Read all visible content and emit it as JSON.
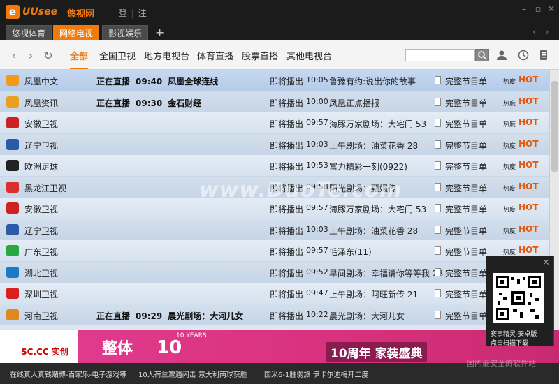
{
  "app": {
    "logo_letter": "e",
    "logo_name": "UUsee",
    "logo_cn": "悠视网",
    "login": "登",
    "register": "注",
    "separator": "|"
  },
  "tabs": [
    {
      "label": "悠视体育"
    },
    {
      "label": "网络电视"
    },
    {
      "label": "影视娱乐"
    }
  ],
  "nav": {
    "categories": [
      "全部",
      "全国卫视",
      "地方电视台",
      "体育直播",
      "股票直播",
      "其他电视台"
    ],
    "search_placeholder": ""
  },
  "columns": {
    "full_schedule": "完整节目单",
    "hot_label": "热度",
    "hot_badge": "HOT",
    "upcoming": "即将播出",
    "live": "正在直播"
  },
  "channels": [
    {
      "name": "凤凰中文",
      "icon_color": "#f29a1c",
      "live_time": "09:40",
      "live_prog": "凤凰全球连线",
      "up_time": "10:05",
      "up_prog": "鲁豫有约:说出你的故事"
    },
    {
      "name": "凤凰资讯",
      "icon_color": "#e8a020",
      "live_time": "09:30",
      "live_prog": "金石财经",
      "up_time": "10:00",
      "up_prog": "凤凰正点播报"
    },
    {
      "name": "安徽卫视",
      "icon_color": "#cc2222",
      "live_time": "",
      "live_prog": "",
      "up_time": "09:57",
      "up_prog": "海豚万家剧场：大宅门 53"
    },
    {
      "name": "辽宁卫视",
      "icon_color": "#2a5aa8",
      "live_time": "",
      "live_prog": "",
      "up_time": "10:03",
      "up_prog": "上午剧场：油菜花香 28"
    },
    {
      "name": "欧洲足球",
      "icon_color": "#222222",
      "live_time": "",
      "live_prog": "",
      "up_time": "10:53",
      "up_prog": "富力精彩一刻(0922)"
    },
    {
      "name": "黑龙江卫视",
      "icon_color": "#d83030",
      "live_time": "",
      "live_prog": "",
      "up_time": "09:58",
      "up_prog": "阳光剧场：甄嬛传"
    },
    {
      "name": "安徽卫视",
      "icon_color": "#cc2222",
      "live_time": "",
      "live_prog": "",
      "up_time": "09:57",
      "up_prog": "海豚万家剧场：大宅门 53"
    },
    {
      "name": "辽宁卫视",
      "icon_color": "#2a5aa8",
      "live_time": "",
      "live_prog": "",
      "up_time": "10:03",
      "up_prog": "上午剧场：油菜花香 28"
    },
    {
      "name": "广东卫视",
      "icon_color": "#2aa840",
      "live_time": "",
      "live_prog": "",
      "up_time": "09:57",
      "up_prog": "毛泽东(11)"
    },
    {
      "name": "湖北卫视",
      "icon_color": "#1a7ac8",
      "live_time": "",
      "live_prog": "",
      "up_time": "09:52",
      "up_prog": "早间剧场：幸福请你等等我 28"
    },
    {
      "name": "深圳卫视",
      "icon_color": "#d82020",
      "live_time": "",
      "live_prog": "",
      "up_time": "09:47",
      "up_prog": "上午剧场：阿旺新传 21"
    },
    {
      "name": "河南卫视",
      "icon_color": "#e08820",
      "live_time": "09:29",
      "live_prog": "晨光剧场：大河儿女",
      "up_time": "10:22",
      "up_prog": "晨光剧场：大河儿女"
    }
  ],
  "watermark": "www.DuoTe.com",
  "banner": {
    "logo": "SC.CC 实创",
    "t1": "整体",
    "t2": "10",
    "t4": "10 YEARS",
    "t3": "10周年 家装盛典"
  },
  "news": [
    "在线真人真钱赌博-百家乐-电子游戏等",
    "10人荷兰遭遇闪击 意大利两球获胜",
    "国米6-1胜弱旅 伊卡尔迪梅开二度"
  ],
  "popup": {
    "line1": "赛事精灵-安卓版",
    "line2": "点击扫描下载"
  },
  "site_tag": "国内最安全的软件站"
}
